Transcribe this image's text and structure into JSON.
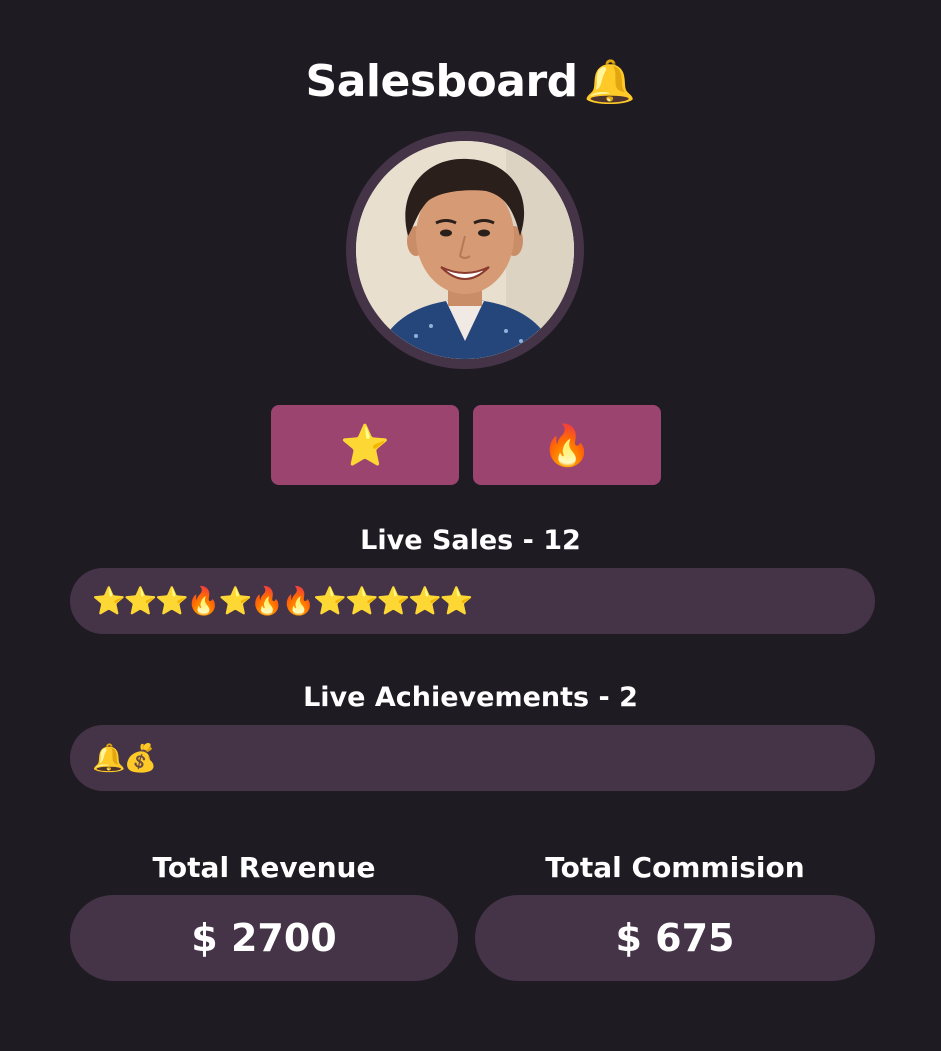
{
  "header": {
    "title": "Salesboard",
    "title_icon": "🔔"
  },
  "actions": {
    "star_button": "⭐",
    "fire_button": "🔥"
  },
  "live_sales": {
    "heading": "Live Sales - 12",
    "icons": "⭐⭐⭐🔥⭐🔥🔥⭐⭐⭐⭐⭐"
  },
  "live_achievements": {
    "heading": "Live Achievements - 2",
    "icons": "🔔💰"
  },
  "totals": {
    "revenue_label": "Total Revenue",
    "revenue_value": "$ 2700",
    "commission_label": "Total Commision",
    "commission_value": "$ 675"
  },
  "colors": {
    "background": "#1f1b22",
    "panel": "#453447",
    "button": "#9b4470",
    "text": "#ffffff"
  }
}
